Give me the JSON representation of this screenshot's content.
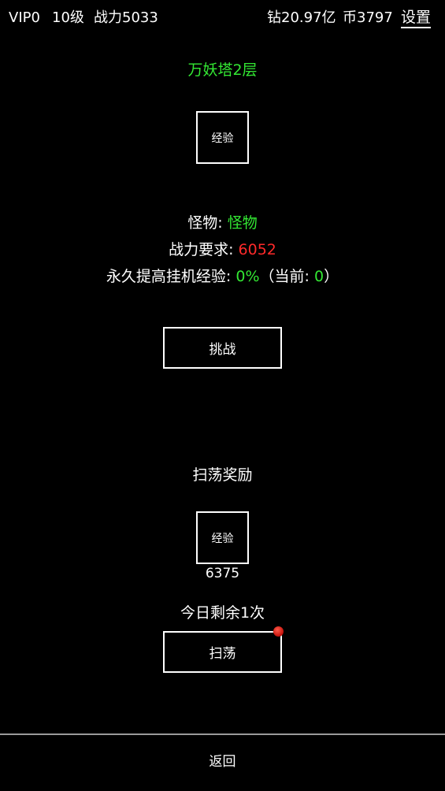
{
  "topbar": {
    "vip": "VIP0",
    "level": "10级",
    "power": "战力5033",
    "diamond": "钻20.97亿",
    "coin": "币3797",
    "settings": "设置"
  },
  "stage": {
    "title": "万妖塔2层",
    "reward_item": "经验",
    "monster_label": "怪物:",
    "monster_name": "怪物",
    "requirement_label": "战力要求:",
    "requirement_value": "6052",
    "bonus_label": "永久提高挂机经验:",
    "bonus_value": "0%",
    "current_open": "（当前:",
    "current_value": "0",
    "current_close": "）",
    "challenge_label": "挑战"
  },
  "sweep": {
    "title": "扫荡奖励",
    "reward_item": "经验",
    "reward_amount": "6375",
    "remaining": "今日剩余1次",
    "button_label": "扫荡"
  },
  "footer": {
    "back_label": "返回"
  },
  "colors": {
    "background": "#000000",
    "highlight_green": "#33e833",
    "warning_red": "#ff2a2a",
    "notification_dot": "#c4110a"
  }
}
